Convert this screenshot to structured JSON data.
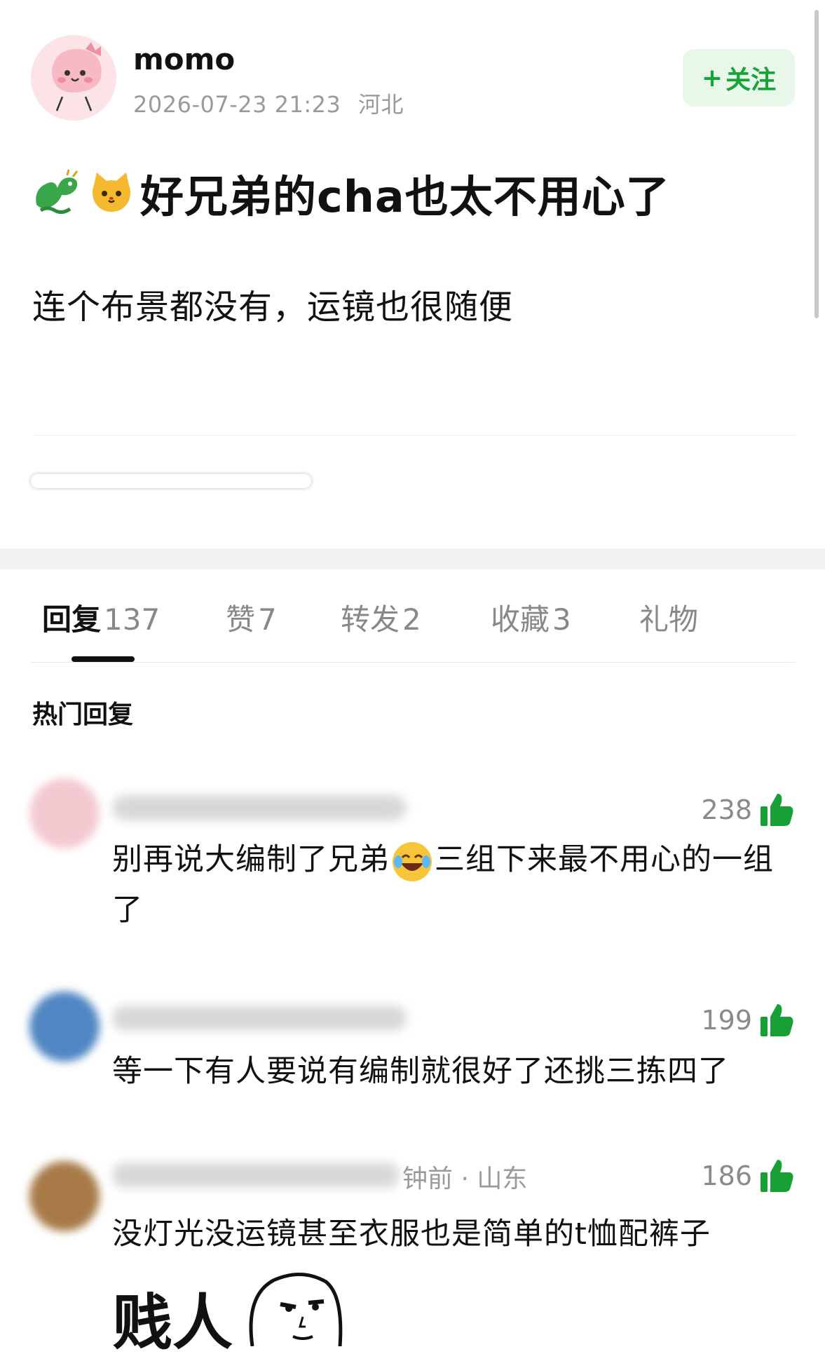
{
  "post": {
    "author": "momo",
    "time": "2026-07-23 21:23",
    "location": "河北",
    "follow_label": "关注",
    "follow_plus": "+",
    "title": "好兄弟的cha也太不用心了",
    "body": "连个布景都没有，运镜也很随便"
  },
  "tabs": [
    {
      "label": "回复",
      "count": "137",
      "active": true
    },
    {
      "label": "赞",
      "count": "7"
    },
    {
      "label": "转发",
      "count": "2"
    },
    {
      "label": "收藏",
      "count": "3"
    },
    {
      "label": "礼物",
      "count": ""
    }
  ],
  "hot_replies": {
    "title": "热门回复",
    "items": [
      {
        "likes": "238",
        "text_a": "别再说大编制了兄弟",
        "text_b": "三组下来最不用心的一组了"
      },
      {
        "likes": "199",
        "text": "等一下有人要说有编制就很好了还挑三拣四了"
      },
      {
        "likes": "186",
        "meta_visible": "钟前 · 山东",
        "text": "没灯光没运镜甚至衣服也是简单的t恤配裤子",
        "meme_text": "贱人"
      }
    ]
  },
  "colors": {
    "accent_green": "#17a437",
    "follow_bg": "#e7f7ea",
    "muted_text": "#9a9a9a"
  },
  "icons": [
    "dragon-emoji-icon",
    "cat-emoji-icon",
    "thumbs-up-icon",
    "laughing-emoji-icon"
  ]
}
